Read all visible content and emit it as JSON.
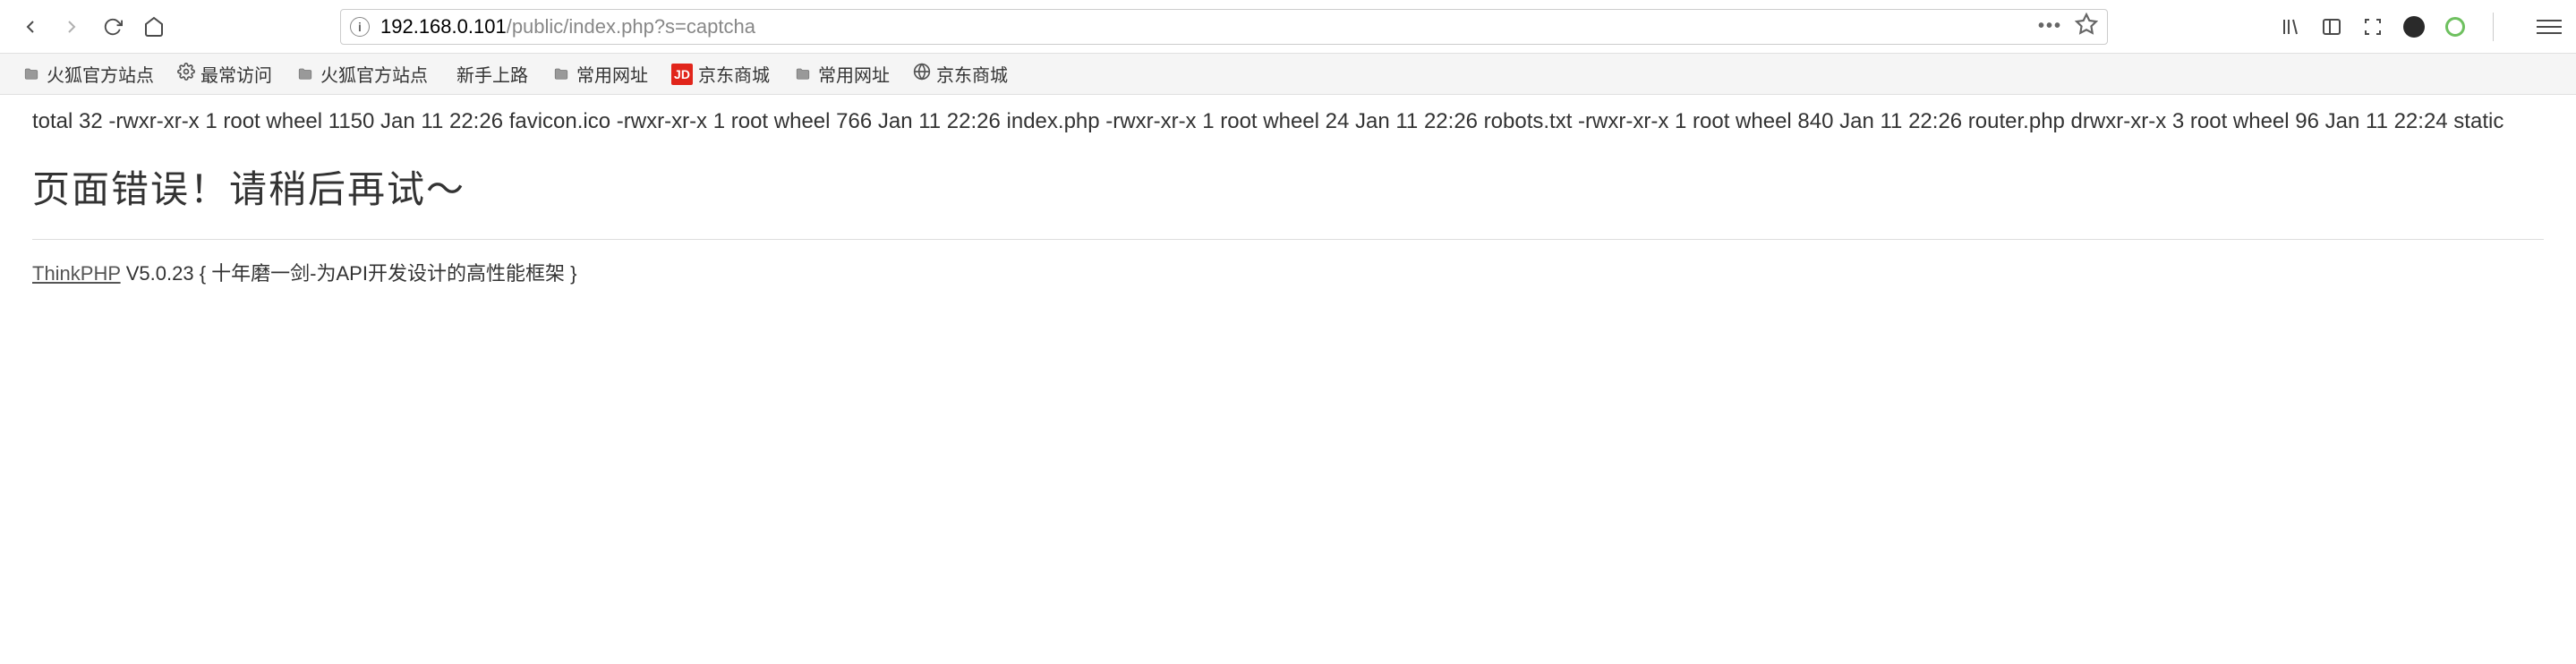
{
  "toolbar": {
    "url_host": "192.168.0.101",
    "url_path": "/public/index.php?s=captcha"
  },
  "bookmarks": [
    {
      "type": "folder",
      "label": "火狐官方站点"
    },
    {
      "type": "gear",
      "label": "最常访问"
    },
    {
      "type": "folder",
      "label": "火狐官方站点"
    },
    {
      "type": "firefox",
      "label": "新手上路"
    },
    {
      "type": "folder",
      "label": "常用网址"
    },
    {
      "type": "jd",
      "label": "京东商城"
    },
    {
      "type": "folder",
      "label": "常用网址"
    },
    {
      "type": "globe",
      "label": "京东商城"
    }
  ],
  "page": {
    "terminal_output": "total 32 -rwxr-xr-x 1 root wheel 1150 Jan 11 22:26 favicon.ico -rwxr-xr-x 1 root wheel 766 Jan 11 22:26 index.php -rwxr-xr-x 1 root wheel 24 Jan 11 22:26 robots.txt -rwxr-xr-x 1 root wheel 840 Jan 11 22:26 router.php drwxr-xr-x 3 root wheel 96 Jan 11 22:24 static",
    "error_heading": "页面错误！请稍后再试～",
    "footer_link": "ThinkPHP",
    "footer_text": " V5.0.23 { 十年磨一剑-为API开发设计的高性能框架 }"
  }
}
